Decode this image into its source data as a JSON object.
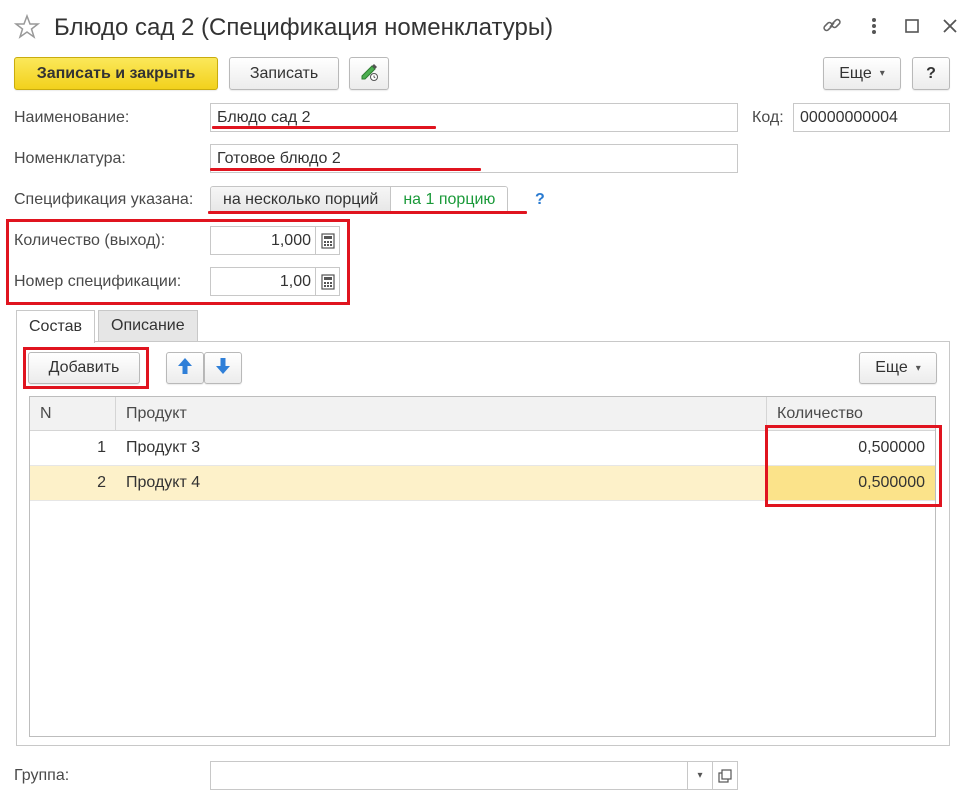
{
  "window": {
    "title": "Блюдо сад 2 (Спецификация номенклатуры)",
    "icons": [
      "star-icon",
      "link-icon",
      "more-vertical-icon",
      "maximize-icon",
      "close-icon"
    ]
  },
  "toolbar": {
    "save_close_label": "Записать и закрыть",
    "save_label": "Записать",
    "more_label": "Еще",
    "help_label": "?"
  },
  "form": {
    "name_label": "Наименование:",
    "name_value": "Блюдо сад 2",
    "code_label": "Код:",
    "code_value": "00000000004",
    "nomenclature_label": "Номенклатура:",
    "nomenclature_value": "Готовое блюдо 2",
    "spec_label": "Спецификация указана:",
    "spec_options": [
      "на несколько порций",
      "на 1 порцию"
    ],
    "spec_help": "?",
    "quantity_label": "Количество (выход):",
    "quantity_value": "1,000",
    "spec_number_label": "Номер спецификации:",
    "spec_number_value": "1,00"
  },
  "tabs": [
    {
      "label": "Состав",
      "active": true
    },
    {
      "label": "Описание",
      "active": false
    }
  ],
  "composition": {
    "add_label": "Добавить",
    "more_label": "Еще",
    "columns": [
      "N",
      "Продукт",
      "Количество"
    ],
    "rows": [
      {
        "n": "1",
        "product": "Продукт 3",
        "qty": "0,500000"
      },
      {
        "n": "2",
        "product": "Продукт 4",
        "qty": "0,500000"
      }
    ]
  },
  "footer": {
    "group_label": "Группа:",
    "group_value": ""
  },
  "colors": {
    "accent_yellow": "#f2d11c",
    "annotation_red": "#e0141f",
    "toggle_green": "#1b9a3a",
    "selected_row": "#fdf1c9"
  }
}
